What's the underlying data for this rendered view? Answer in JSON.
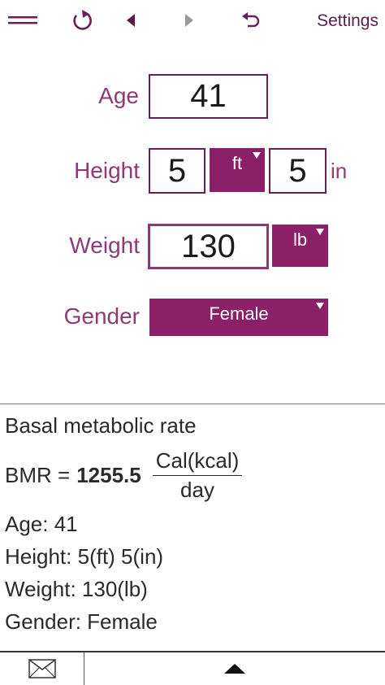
{
  "toolbar": {
    "menu_icon": "hamburger-icon",
    "refresh_icon": "refresh-icon",
    "back_icon": "triangle-left-icon",
    "forward_icon": "triangle-right-icon",
    "undo_icon": "undo-icon",
    "settings_label": "Settings"
  },
  "form": {
    "age": {
      "label": "Age",
      "value": "41"
    },
    "height": {
      "label": "Height",
      "ft_value": "5",
      "ft_unit": "ft",
      "in_value": "5",
      "in_unit": "in"
    },
    "weight": {
      "label": "Weight",
      "value": "130",
      "unit": "lb"
    },
    "gender": {
      "label": "Gender",
      "value": "Female"
    }
  },
  "result": {
    "title": "Basal metabolic rate",
    "bmr_prefix": "BMR =",
    "bmr_value": "1255.5",
    "unit_numerator": "Cal(kcal)",
    "unit_denominator": "day",
    "age_line": "Age: 41",
    "height_line": "Height: 5(ft) 5(in)",
    "weight_line": "Weight: 130(lb)",
    "gender_line": "Gender: Female"
  },
  "bottom": {
    "mail_icon": "envelope-icon",
    "expand_icon": "triangle-up-icon"
  },
  "colors": {
    "accent": "#8b1f68",
    "label": "#8f3a73",
    "icon": "#6b1f57"
  }
}
